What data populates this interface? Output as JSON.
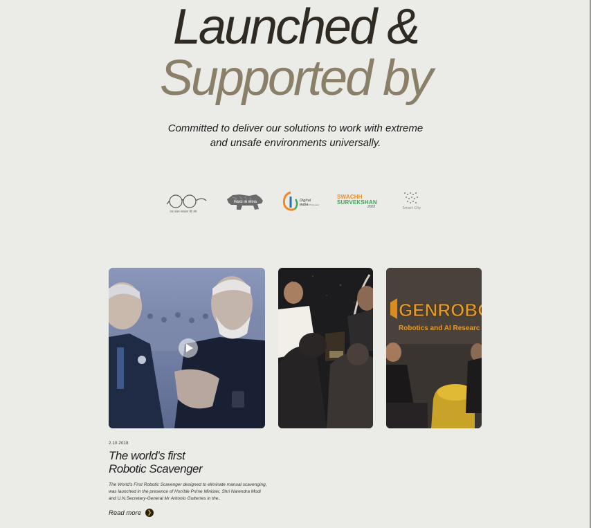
{
  "hero": {
    "line1": "Launched &",
    "line2": "Supported by",
    "subtitle_line1": "Committed to deliver our solutions to work with extreme",
    "subtitle_line2": "and unsafe environments universally."
  },
  "logos": [
    {
      "name": "swachh-bharat-logo",
      "text": "एक कदम स्वच्छता की ओर"
    },
    {
      "name": "make-in-india-logo",
      "text": "MAKE IN INDIA"
    },
    {
      "name": "digital-india-logo",
      "text": "Digital India",
      "subtext": "Power To Empower"
    },
    {
      "name": "swachh-survekshan-logo",
      "text_line1": "SWACHH",
      "text_line2": "SURVEKSHAN",
      "year": "2022"
    },
    {
      "name": "smart-city-logo",
      "text": "Smart City"
    }
  ],
  "cards": [
    {
      "name": "video-card-launch",
      "has_play": true
    },
    {
      "name": "photo-card-award"
    },
    {
      "name": "photo-card-genrobotics",
      "sign_text": "GENROBOT",
      "sign_subtext": "Robotics and AI Researc"
    }
  ],
  "story": {
    "date": "2.10.2018",
    "title": "The world’s first\nRobotic Scavenger",
    "description": "The World's First Robotic Scavenger designed to eliminate manual scavenging, was launched in the presence of Hon'ble Prime Minister, Shri Narendra Modi and U.N.Secretary-General Mr Antonio Gutterres in the..",
    "read_more": "Read more",
    "read_more_icon": "arrow-right-icon"
  },
  "colors": {
    "background": "#ebebe7",
    "title_dark": "#2f2a22",
    "title_light": "#8a7f68",
    "accent": "#d9a63a"
  }
}
